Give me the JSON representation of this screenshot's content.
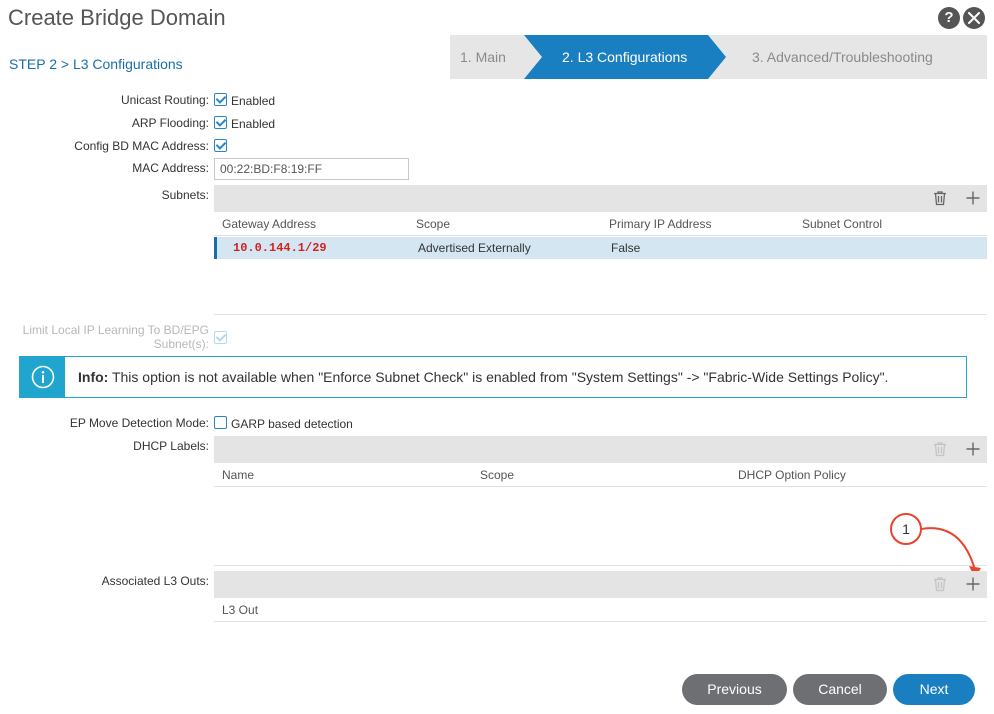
{
  "window": {
    "title": "Create Bridge Domain"
  },
  "header": {
    "help_symbol": "?"
  },
  "step_label": "STEP 2 > L3 Configurations",
  "wizard": {
    "steps": [
      {
        "label": "1. Main",
        "active": false
      },
      {
        "label": "2. L3 Configurations",
        "active": true
      },
      {
        "label": "3. Advanced/Troubleshooting",
        "active": false
      }
    ]
  },
  "form": {
    "unicast_routing": {
      "label": "Unicast Routing:",
      "checked": true,
      "text": "Enabled"
    },
    "arp_flooding": {
      "label": "ARP Flooding:",
      "checked": true,
      "text": "Enabled"
    },
    "config_bd_mac": {
      "label": "Config BD MAC Address:",
      "checked": true
    },
    "mac_address": {
      "label": "MAC Address:",
      "value": "00:22:BD:F8:19:FF"
    },
    "subnets": {
      "label": "Subnets:",
      "columns": [
        "Gateway Address",
        "Scope",
        "Primary IP Address",
        "Subnet Control"
      ],
      "rows": [
        {
          "gateway": "10.0.144.1/29",
          "scope": "Advertised Externally",
          "primary": "False",
          "control": ""
        }
      ]
    },
    "limit_local_ip": {
      "label_line1": "Limit Local IP Learning To BD/EPG",
      "label_line2": "Subnet(s):",
      "checked": true,
      "disabled": true
    },
    "info": {
      "prefix": "Info:",
      "message": "This option is not available when \"Enforce Subnet Check\" is enabled from \"System Settings\" -> \"Fabric-Wide Settings Policy\"."
    },
    "ep_move": {
      "label": "EP Move Detection Mode:",
      "checked": false,
      "text": "GARP based detection"
    },
    "dhcp_labels": {
      "label": "DHCP Labels:",
      "columns": [
        "Name",
        "Scope",
        "DHCP Option Policy"
      ]
    },
    "l3_outs": {
      "label": "Associated L3 Outs:",
      "columns": [
        "L3 Out"
      ]
    }
  },
  "callout": {
    "number": "1",
    "color": "#e8432c"
  },
  "buttons": {
    "previous": "Previous",
    "cancel": "Cancel",
    "next": "Next"
  },
  "colors": {
    "accent": "#1a7fc1",
    "active_step": "#1a7fc1",
    "info_blue": "#20a6ce",
    "gateway_red": "#d42020"
  }
}
